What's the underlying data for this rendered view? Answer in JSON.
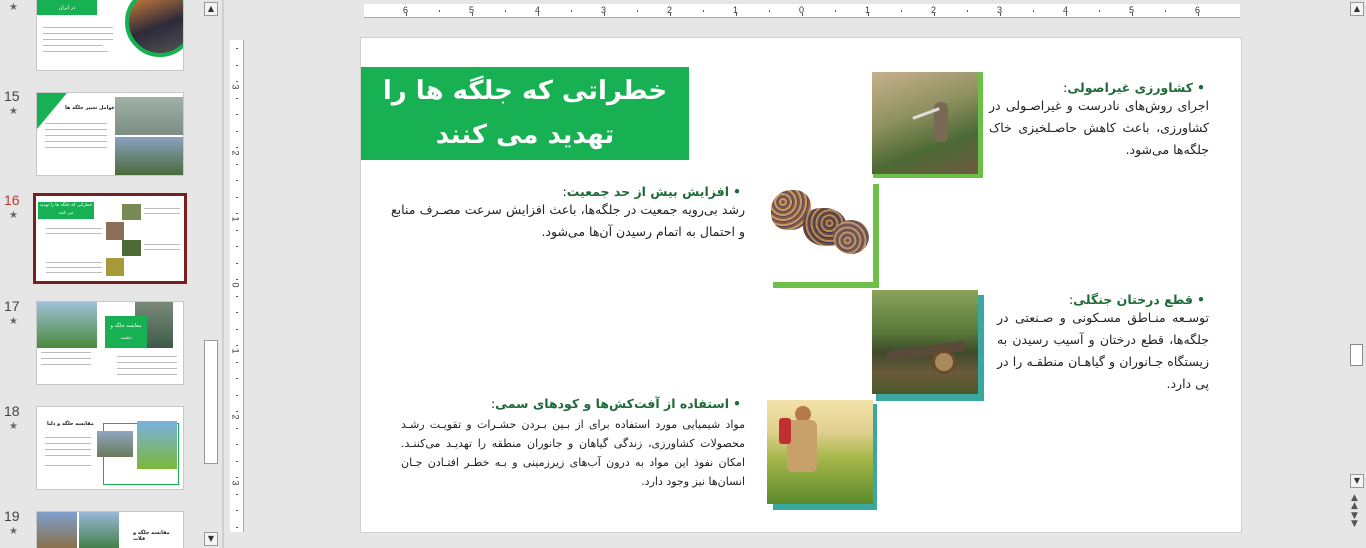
{
  "thumbnails": [
    {
      "number": "",
      "title": "در ایران"
    },
    {
      "number": "15",
      "title": "عوامل تغییر جلگه ها"
    },
    {
      "number": "16",
      "title": "خطراتی که جلگه ها را تهدید می کنند"
    },
    {
      "number": "17",
      "title": "مقایسه جلگه و دشت"
    },
    {
      "number": "18",
      "title": "مقایسه جلگه و دلتا"
    },
    {
      "number": "19",
      "title": "مقایسه جلگه و فلات"
    }
  ],
  "star_glyph": "★",
  "hruler_labels": [
    "6",
    "5",
    "4",
    "3",
    "2",
    "1",
    "0",
    "1",
    "2",
    "3",
    "4",
    "5",
    "6"
  ],
  "vruler_labels": [
    "3",
    "2",
    "1",
    "0",
    "1",
    "2",
    "3"
  ],
  "slide": {
    "title": "خطراتی که جلگه ها را تهدید می کنند",
    "items": [
      {
        "heading": "کشاورزی غیراصولی",
        "colon": ":",
        "text": "اجرای روش‌های نادرست و غیراصـولی در کشاورزی، باعث کاهش حاصـلخیزی خاک جلگه‌ها می‌شود."
      },
      {
        "heading": "افزایش بیش از حد جمعیت",
        "colon": ":",
        "text": "رشد بی‌رویه جمعیت در جلگه‌ها، باعث افزایش سرعت مصـرف منابع و احتمال به اتمام رسیدن آن‌ها می‌شود."
      },
      {
        "heading": "قطع درختان جنگلی",
        "colon": ":",
        "text": "توسـعه منـاطق مسـکونی و صـنعتی در جلگه‌ها، قطع درختان و آسیب رسیدن به زیستگاه جـانوران و گیاهـان منطقـه را در پی دارد."
      },
      {
        "heading": "استفاده از آفت‌کش‌ها و کودهای سمی",
        "colon": ":",
        "text": "مواد شیمیایی مورد استفاده برای از بـین بـردن حشـرات و تقویـت رشـد محصولات کشاورزی، زندگی گیاهان و جانوران منطقه را تهدیـد می‌کننـد. امکان نفوذ این مواد به درون آب‌های زیرزمینی و بـه خطـر افتـادن جـان انسان‌ها نیز وجود دارد."
      }
    ],
    "bullet": "•"
  },
  "colors": {
    "accent": "#17b153",
    "frame_green": "#6cc04a",
    "frame_teal": "#3aa8a0",
    "selected_border": "#7a1f1f"
  }
}
